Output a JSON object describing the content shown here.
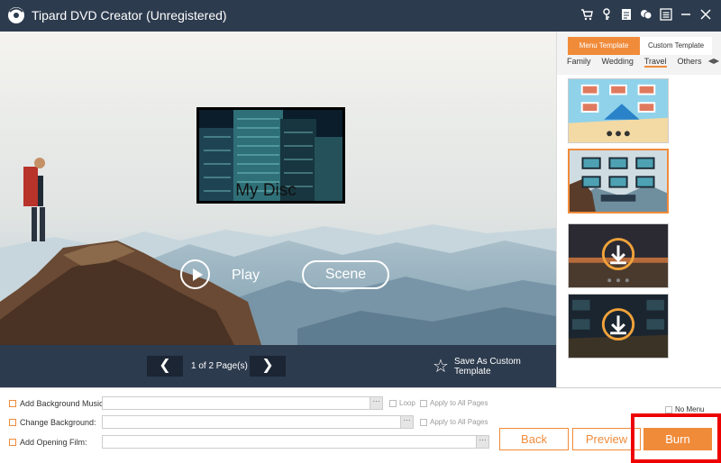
{
  "window": {
    "title": "Tipard DVD Creator (Unregistered)",
    "icons": [
      "cart-icon",
      "key-icon",
      "document-icon",
      "chat-icon",
      "menu-icon",
      "minimize-icon",
      "close-icon"
    ]
  },
  "preview": {
    "disc_title": "My Disc",
    "play_label": "Play",
    "scene_label": "Scene"
  },
  "pager": {
    "page_text": "1 of 2 Page(s)",
    "prev_glyph": "❮",
    "next_glyph": "❯",
    "save_template_label": "Save As Custom Template"
  },
  "template_panel": {
    "tabs": [
      {
        "label": "Menu Template",
        "active": true
      },
      {
        "label": "Custom Template",
        "active": false
      }
    ],
    "categories": [
      "Family",
      "Wedding",
      "Travel",
      "Others"
    ],
    "selected_category": "Travel",
    "templates": [
      {
        "name": "beach-template",
        "selected": false,
        "downloadable": false
      },
      {
        "name": "mountain-template",
        "selected": true,
        "downloadable": false
      },
      {
        "name": "sunset-template",
        "selected": false,
        "downloadable": true
      },
      {
        "name": "night-city-template",
        "selected": false,
        "downloadable": true
      }
    ]
  },
  "options": {
    "bg_music_label": "Add Background Music:",
    "change_bg_label": "Change Background:",
    "opening_film_label": "Add Opening Film:",
    "loop_label": "Loop",
    "apply_all_label": "Apply to All Pages",
    "no_menu_label": "No Menu",
    "dots": "···"
  },
  "actions": {
    "back": "Back",
    "preview": "Preview",
    "burn": "Burn"
  },
  "colors": {
    "accent": "#f08b3a",
    "dark": "#2d3b4e",
    "highlight": "#ee0000"
  }
}
